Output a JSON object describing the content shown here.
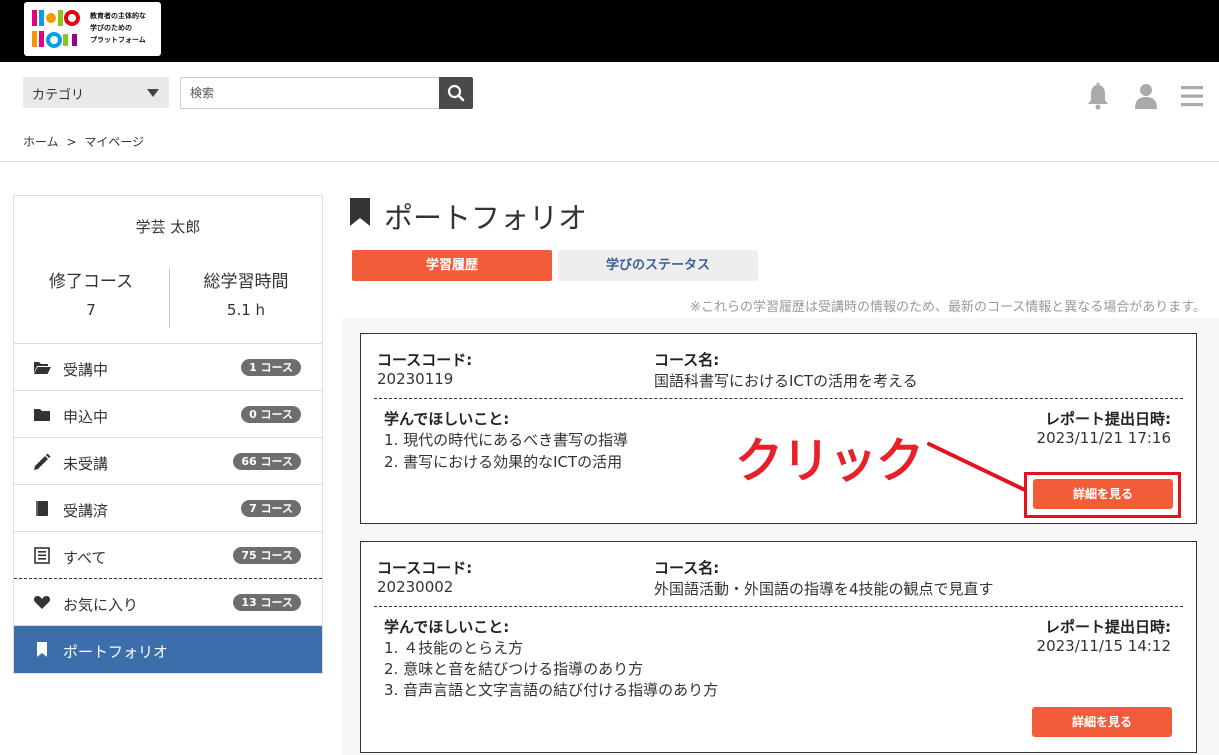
{
  "logo": {
    "text_lines": [
      "教育者の主体的な",
      "学びのための",
      "プラットフォーム"
    ]
  },
  "header": {
    "category_label": "カテゴリ",
    "search_placeholder": "検索"
  },
  "breadcrumb": {
    "home": "ホーム",
    "separator": ">",
    "current": "マイページ"
  },
  "sidebar": {
    "user_name": "学芸 太郎",
    "stats": [
      {
        "label": "修了コース",
        "value": "7"
      },
      {
        "label": "総学習時間",
        "value": "5.1 h"
      }
    ],
    "items": [
      {
        "label": "受講中",
        "count": "1 コース",
        "icon": "folder-open-icon"
      },
      {
        "label": "申込中",
        "count": "0 コース",
        "icon": "folder-icon"
      },
      {
        "label": "未受講",
        "count": "66 コース",
        "icon": "pencil-icon"
      },
      {
        "label": "受講済",
        "count": "7 コース",
        "icon": "book-icon"
      },
      {
        "label": "すべて",
        "count": "75 コース",
        "icon": "list-icon"
      },
      {
        "label": "お気に入り",
        "count": "13 コース",
        "icon": "heart-icon"
      },
      {
        "label": "ポートフォリオ",
        "icon": "bookmark-icon",
        "active": true
      }
    ]
  },
  "main": {
    "title": "ポートフォリオ",
    "tabs": [
      {
        "label": "学習履歴",
        "active": true
      },
      {
        "label": "学びのステータス",
        "active": false
      }
    ],
    "note": "※これらの学習履歴は受講時の情報のため、最新のコース情報と異なる場合があります。",
    "labels": {
      "course_code": "コースコード:",
      "course_name": "コース名:",
      "goals": "学んでほしいこと:",
      "report_date": "レポート提出日時:",
      "detail_button": "詳細を見る"
    },
    "cards": [
      {
        "code": "20230119",
        "name": "国語科書写におけるICTの活用を考える",
        "goals": [
          "1. 現代の時代にあるべき書写の指導",
          "2. 書写における効果的なICTの活用"
        ],
        "date": "2023/11/21 17:16"
      },
      {
        "code": "20230002",
        "name": "外国語活動・外国語の指導を4技能の観点で見直す",
        "goals": [
          "1. ４技能のとらえ方",
          "2. 意味と音を結びつける指導のあり方",
          "3. 音声言語と文字言語の結び付ける指導のあり方"
        ],
        "date": "2023/11/15 14:12"
      }
    ]
  },
  "annotation": {
    "label": "クリック",
    "color": "#e8202a"
  },
  "colors": {
    "accent": "#f25c38",
    "sidebar_active": "#3b6eab",
    "badge": "#6e6e6e"
  }
}
